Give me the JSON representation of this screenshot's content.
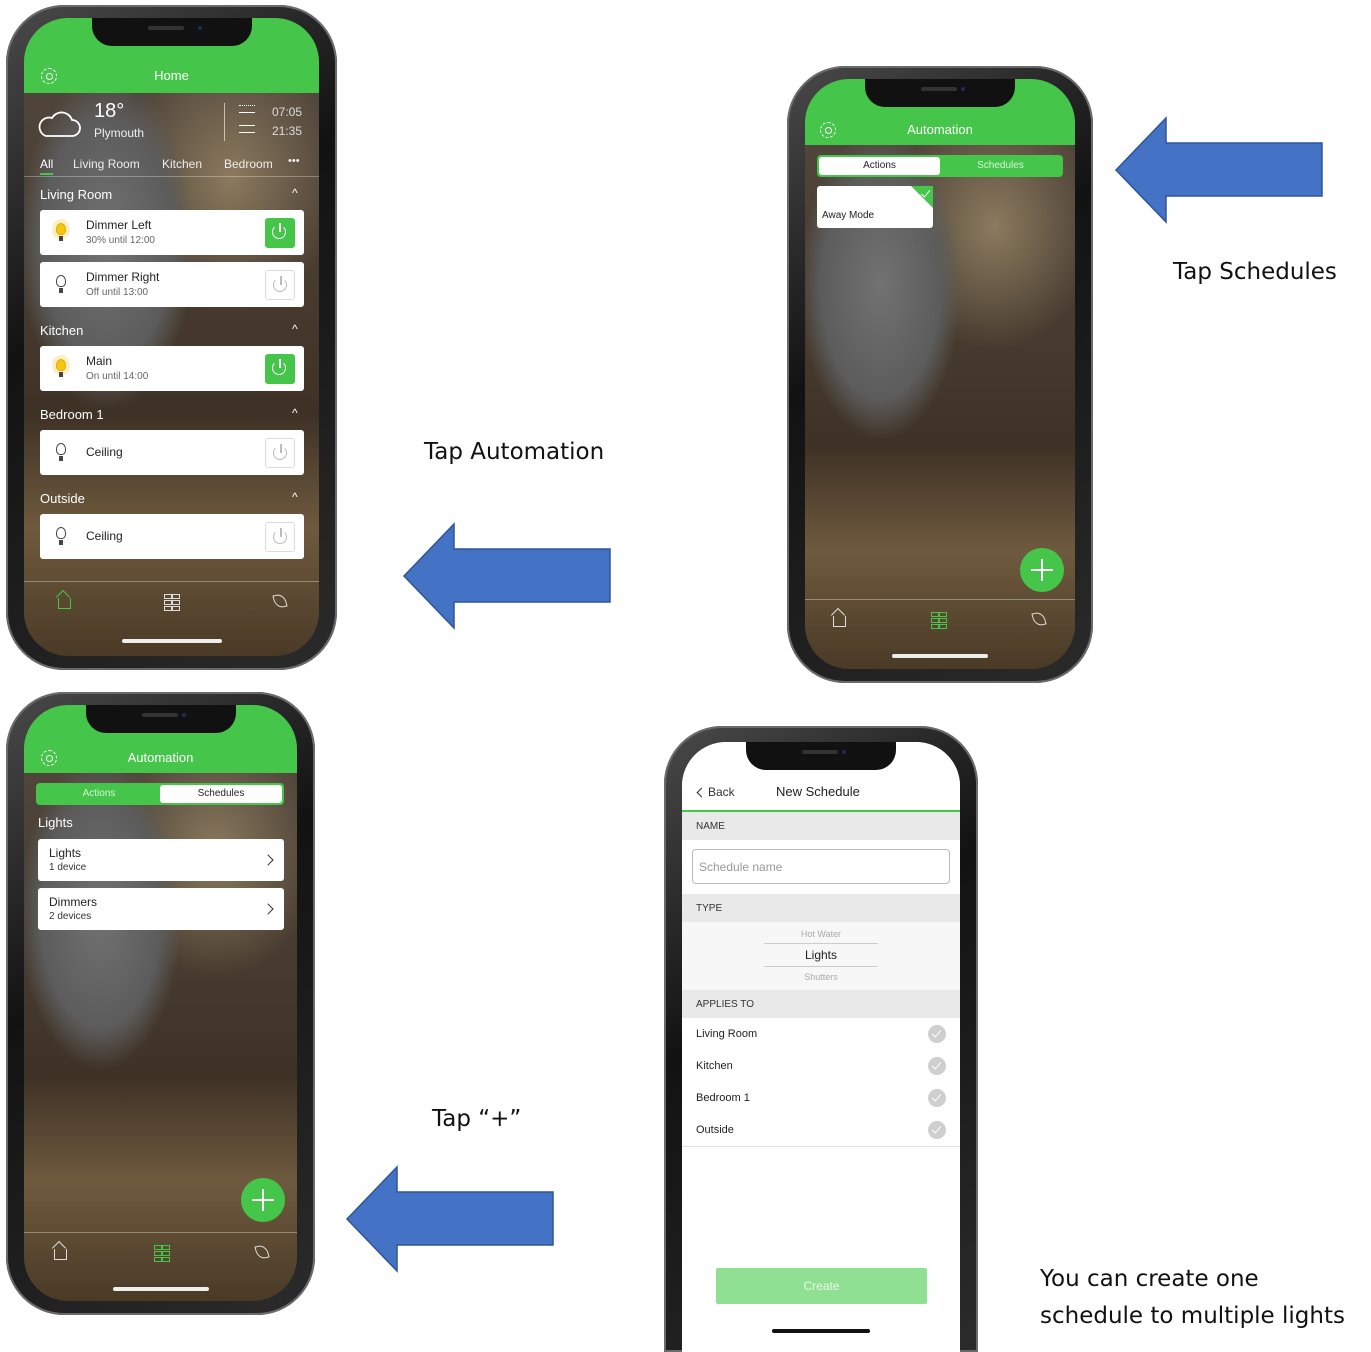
{
  "captions": {
    "tap_automation": "Tap Automation",
    "tap_schedules": "Tap Schedules",
    "tap_plus": "Tap “+”",
    "note_line1": "You can create one",
    "note_line2": "schedule to multiple lights"
  },
  "screen_home": {
    "title": "Home",
    "weather": {
      "temp": "18°",
      "city": "Plymouth",
      "sunrise": "07:05",
      "sunset": "21:35",
      "icon": "cloud-icon"
    },
    "room_tabs": [
      "All",
      "Living Room",
      "Kitchen",
      "Bedroom",
      "•••"
    ],
    "sections": [
      {
        "name": "Living Room",
        "devices": [
          {
            "name": "Dimmer Left",
            "status": "30% until 12:00",
            "on": true
          },
          {
            "name": "Dimmer Right",
            "status": "Off until 13:00",
            "on": false
          }
        ]
      },
      {
        "name": "Kitchen",
        "devices": [
          {
            "name": "Main",
            "status": "On until 14:00",
            "on": true
          }
        ]
      },
      {
        "name": "Bedroom 1",
        "devices": [
          {
            "name": "Ceiling",
            "status": "",
            "on": false
          }
        ]
      },
      {
        "name": "Outside",
        "devices": [
          {
            "name": "Ceiling",
            "status": "",
            "on": false
          }
        ]
      }
    ],
    "nav_icons": [
      "home-icon",
      "grid-icon",
      "leaf-icon"
    ],
    "active_nav": "home-icon"
  },
  "screen_automation_actions": {
    "title": "Automation",
    "tabs": [
      "Actions",
      "Schedules"
    ],
    "active_tab": "Actions",
    "action_tile": "Away Mode",
    "active_nav": "grid-icon"
  },
  "screen_automation_schedules": {
    "title": "Automation",
    "tabs": [
      "Actions",
      "Schedules"
    ],
    "active_tab": "Schedules",
    "section": "Lights",
    "groups": [
      {
        "name": "Lights",
        "count": "1 device"
      },
      {
        "name": "Dimmers",
        "count": "2 devices"
      }
    ],
    "active_nav": "grid-icon"
  },
  "screen_new_schedule": {
    "back": "Back",
    "title": "New Schedule",
    "name_header": "NAME",
    "name_placeholder": "Schedule name",
    "type_header": "TYPE",
    "type_options": [
      "Hot Water",
      "Lights",
      "Shutters"
    ],
    "type_selected": "Lights",
    "applies_header": "APPLIES TO",
    "rooms": [
      "Living Room",
      "Kitchen",
      "Bedroom 1",
      "Outside"
    ],
    "create": "Create"
  },
  "colors": {
    "brand_green": "#45c64a",
    "arrow_blue": "#4472c4"
  }
}
